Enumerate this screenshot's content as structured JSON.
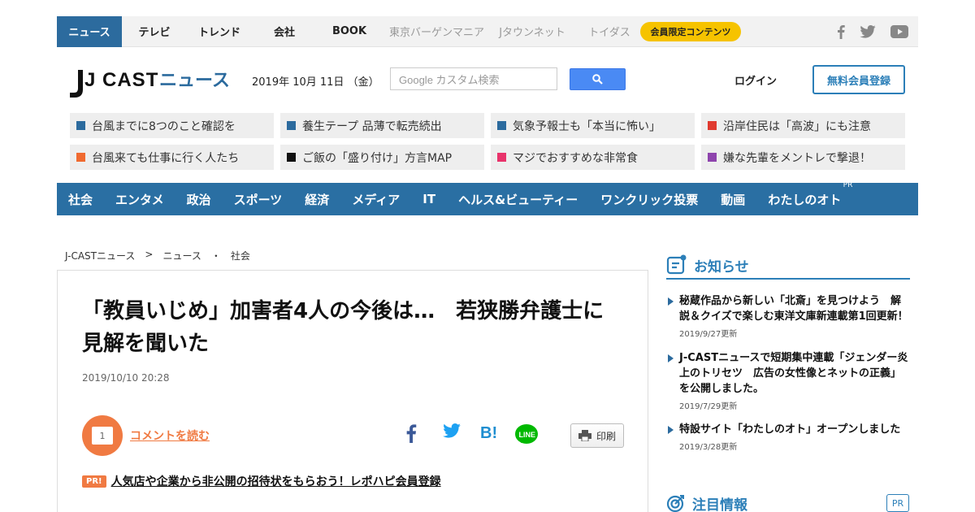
{
  "topnav": {
    "items": [
      {
        "label": "ニュース",
        "active": true
      },
      {
        "label": "テレビ"
      },
      {
        "label": "トレンド"
      },
      {
        "label": "会社"
      },
      {
        "label": "BOOK"
      },
      {
        "label": "東京バーゲンマニア"
      },
      {
        "label": "Jタウンネット"
      },
      {
        "label": "トイダス"
      }
    ],
    "member_badge": "会員限定コンテンツ",
    "social": [
      "facebook-icon",
      "twitter-icon",
      "youtube-icon"
    ]
  },
  "header": {
    "logo_text": "J CAST",
    "logo_sub": "ニュース",
    "date": "2019年 10月 11日 （金）",
    "search_placeholder": "Google カスタム検索",
    "login": "ログイン",
    "register": "無料会員登録"
  },
  "topics": [
    {
      "label": "台風までに8つのこと確認を",
      "color": "#2c6b9e"
    },
    {
      "label": "養生テープ 品薄で転売続出",
      "color": "#2c6b9e"
    },
    {
      "label": "気象予報士も「本当に怖い」",
      "color": "#2c6b9e"
    },
    {
      "label": "沿岸住民は「高波」にも注意",
      "color": "#e03a2f"
    },
    {
      "label": "台風来ても仕事に行く人たち",
      "color": "#f06a30"
    },
    {
      "label": "ご飯の「盛り付け」方言MAP",
      "color": "#111111"
    },
    {
      "label": "マジでおすすめな非常食",
      "color": "#e8336b"
    },
    {
      "label": "嫌な先輩をメントレで撃退！",
      "color": "#8e44ad"
    }
  ],
  "categories": [
    "社会",
    "エンタメ",
    "政治",
    "スポーツ",
    "経済",
    "メディア",
    "IT",
    "ヘルス&ビューティー",
    "ワンクリック投票",
    "動画",
    "わたしのオト"
  ],
  "categories_pr": "PR",
  "breadcrumb": [
    "J-CASTニュース",
    ">",
    "ニュース",
    "・",
    "社会"
  ],
  "article": {
    "title": "「教員いじめ」加害者4人の今後は…　若狭勝弁護士に見解を聞いた",
    "date": "2019/10/10 20:28",
    "comment_count": "1",
    "comment_link": "コメントを読む",
    "print": "印刷",
    "pr_tag": "PR!",
    "pr_text": "人気店や企業から非公開の招待状をもらおう！レポハピ会員登録"
  },
  "sidebar": {
    "notice_title": "お知らせ",
    "notices": [
      {
        "title": "秘蔵作品から新しい「北斎」を見つけよう　解説＆クイズで楽しむ東洋文庫新連載第1回更新！",
        "date": "2019/9/27更新"
      },
      {
        "title": "J-CASTニュースで短期集中連載「ジェンダー炎上のトリセツ　広告の女性像とネットの正義」を公開しました。",
        "date": "2019/7/29更新"
      },
      {
        "title": "特設サイト「わたしのオト」オープンしました",
        "date": "2019/3/28更新"
      }
    ],
    "focus_title": "注目情報",
    "focus_pr": "PR"
  },
  "colors": {
    "brand": "#2c6b9e",
    "accent": "#f07a42",
    "badge": "#f6c300"
  }
}
